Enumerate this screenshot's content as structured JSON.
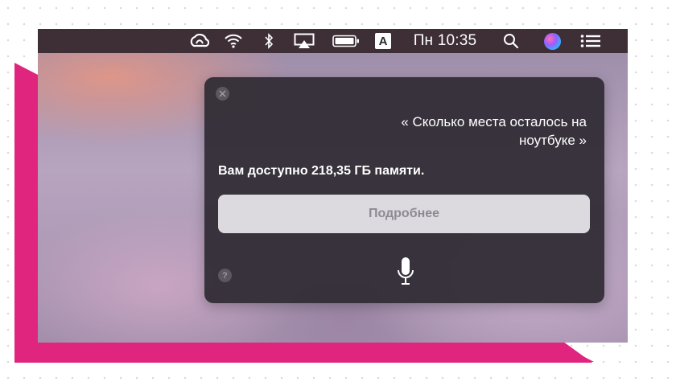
{
  "menubar": {
    "icons": [
      "creative-cloud-icon",
      "wifi-icon",
      "bluetooth-icon",
      "airplay-icon",
      "battery-icon"
    ],
    "input_source": "A",
    "clock": "Пн 10:35",
    "right_icons": [
      "spotlight-search-icon",
      "siri-icon",
      "notification-center-icon"
    ]
  },
  "siri": {
    "query": "« Сколько места осталось на ноутбуке »",
    "answer": "Вам доступно 218,35 ГБ памяти.",
    "more_button": "Подробнее",
    "help": "?"
  },
  "colors": {
    "accent_pink": "#e0257e",
    "menubar_bg": "#3d2f35",
    "panel_bg": "#302c34",
    "button_bg": "#dcdadf"
  }
}
